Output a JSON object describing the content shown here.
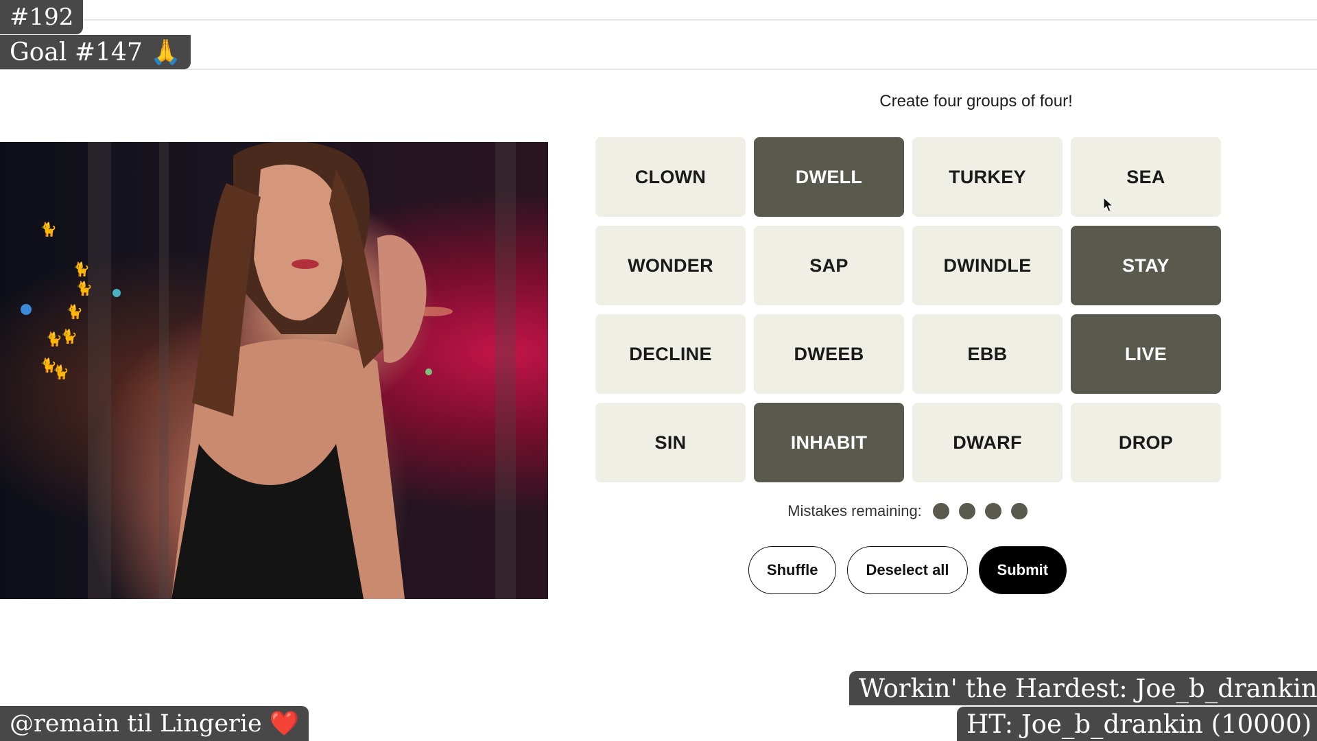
{
  "overlays": {
    "counter": "#192",
    "goal": "Goal #147 🙏",
    "remain": "@remain til Lingerie ❤️",
    "hardest": "Workin' the Hardest: Joe_b_drankin",
    "ht": "HT: Joe_b_drankin (10000)"
  },
  "game": {
    "instruction": "Create four groups of four!",
    "tiles": [
      {
        "word": "CLOWN",
        "selected": false
      },
      {
        "word": "DWELL",
        "selected": true
      },
      {
        "word": "TURKEY",
        "selected": false
      },
      {
        "word": "SEA",
        "selected": false
      },
      {
        "word": "WONDER",
        "selected": false
      },
      {
        "word": "SAP",
        "selected": false
      },
      {
        "word": "DWINDLE",
        "selected": false
      },
      {
        "word": "STAY",
        "selected": true
      },
      {
        "word": "DECLINE",
        "selected": false
      },
      {
        "word": "DWEEB",
        "selected": false
      },
      {
        "word": "EBB",
        "selected": false
      },
      {
        "word": "LIVE",
        "selected": true
      },
      {
        "word": "SIN",
        "selected": false
      },
      {
        "word": "INHABIT",
        "selected": true
      },
      {
        "word": "DWARF",
        "selected": false
      },
      {
        "word": "DROP",
        "selected": false
      }
    ],
    "mistakes_label": "Mistakes remaining:",
    "mistakes_remaining": 4,
    "buttons": {
      "shuffle": "Shuffle",
      "deselect": "Deselect all",
      "submit": "Submit"
    }
  },
  "colors": {
    "tile_default": "#efefe6",
    "tile_selected": "#5a594e",
    "overlay_bg": "#3a3a3a",
    "cat_emote": "#f1b233"
  },
  "icons": {
    "emote": "cat-emote-icon",
    "cursor": "mouse-cursor-icon",
    "mistake": "mistake-dot-icon"
  }
}
